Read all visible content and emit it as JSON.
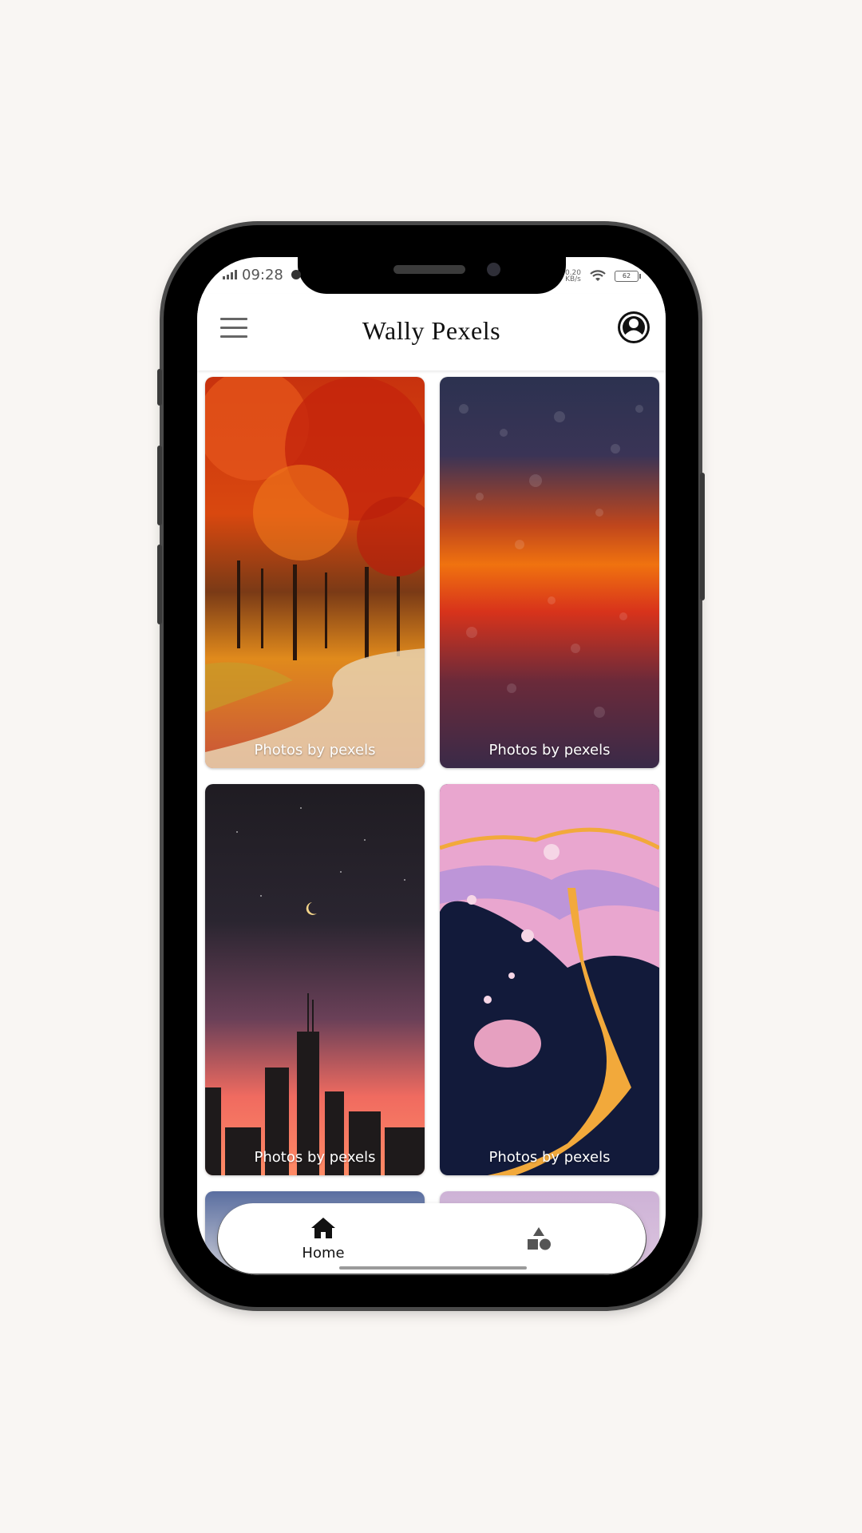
{
  "status_bar": {
    "time": "09:28",
    "net_speed_value": "0.20",
    "net_speed_unit": "KB/s",
    "battery": "62",
    "icons": [
      "signal-icon",
      "camera-dot-icon",
      "wifi-icon",
      "battery-icon"
    ]
  },
  "app_bar": {
    "title": "Wally Pexels",
    "menu_icon": "menu-icon",
    "account_icon": "account-circle-icon"
  },
  "wallpapers": [
    {
      "label": "Photos by pexels",
      "subject": "autumn forest path"
    },
    {
      "label": "Photos by pexels",
      "subject": "raindrops on glass at sunset"
    },
    {
      "label": "Photos by pexels",
      "subject": "city skyline at dusk with moon"
    },
    {
      "label": "Photos by pexels",
      "subject": "paint splatter abstract"
    }
  ],
  "bottom_nav": {
    "items": [
      {
        "label": "Home",
        "icon": "home-icon",
        "active": true
      },
      {
        "label": "",
        "icon": "categories-icon",
        "active": false
      }
    ]
  },
  "colors": {
    "background": "#f9f6f3",
    "phone_frame": "#000000",
    "title_text": "#111111"
  }
}
